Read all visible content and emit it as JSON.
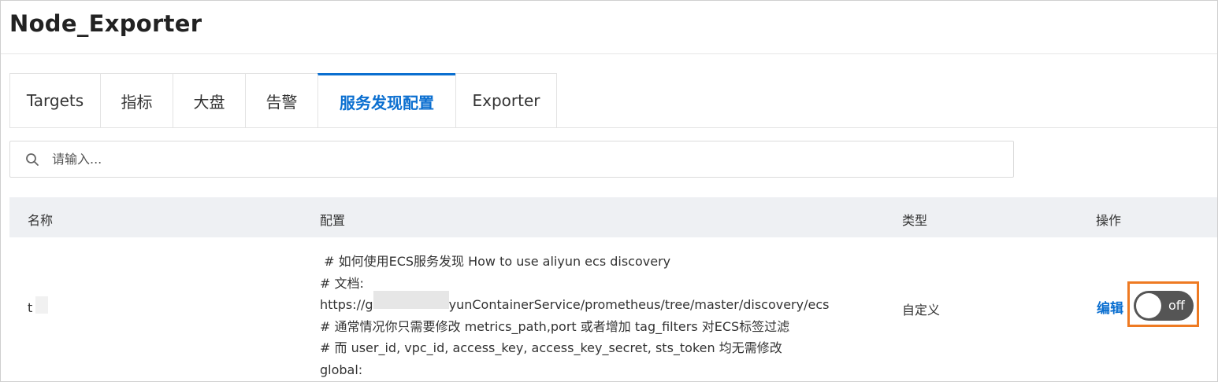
{
  "page": {
    "title": "Node_Exporter"
  },
  "tabs": [
    {
      "label": "Targets",
      "active": false
    },
    {
      "label": "指标",
      "active": false
    },
    {
      "label": "大盘",
      "active": false
    },
    {
      "label": "告警",
      "active": false
    },
    {
      "label": "服务发现配置",
      "active": true
    },
    {
      "label": "Exporter",
      "active": false
    }
  ],
  "search": {
    "placeholder": "请输入...",
    "value": "",
    "icon": "search-icon"
  },
  "table": {
    "columns": [
      "名称",
      "配置",
      "类型",
      "操作"
    ],
    "rows": [
      {
        "name": "t",
        "config_lines": [
          " # 如何使用ECS服务发现 How to use aliyun ecs discovery",
          "# 文档:",
          "https://g               AliyunContainerService/prometheus/tree/master/discovery/ecs",
          "# 通常情况你只需要修改 metrics_path,port 或者增加 tag_filters 对ECS标签过滤",
          "# 而 user_id, vpc_id, access_key, access_key_secret, sts_token 均无需修改",
          "global:"
        ],
        "type": "自定义",
        "edit_label": "编辑",
        "toggle_label": "off",
        "toggle_on": false
      }
    ]
  },
  "colors": {
    "accent": "#0b6fd0",
    "highlight": "#ee7a22",
    "toggle_off": "#555555",
    "header_bg": "#eef0f3"
  }
}
